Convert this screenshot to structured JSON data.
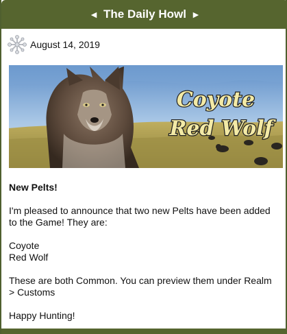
{
  "header": {
    "prev_glyph": "◄",
    "title": "The Daily Howl",
    "next_glyph": "►"
  },
  "post": {
    "icon": "snowflake-icon",
    "date": "August 14, 2019"
  },
  "banner": {
    "line1": "Coyote",
    "line2": "Red Wolf"
  },
  "article": {
    "heading": "New Pelts!",
    "intro": "I'm pleased to announce that two new Pelts have been added to the Game! They are:",
    "pelts": [
      "Coyote",
      "Red Wolf"
    ],
    "note": "These are both Common. You can preview them under Realm > Customs",
    "signoff": "Happy Hunting!"
  },
  "colors": {
    "header_bg": "#56652f",
    "header_text": "#ffffff",
    "banner_text": "#f3eaa6"
  }
}
